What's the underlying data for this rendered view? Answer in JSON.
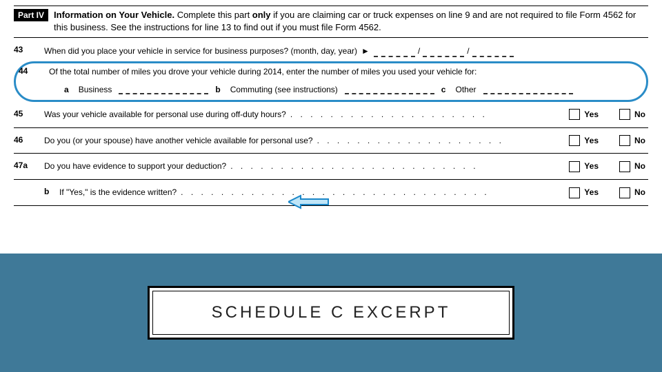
{
  "part": {
    "chip": "Part IV",
    "title": "Information on Your Vehicle.",
    "instruction_a": "Complete this part ",
    "only_word": "only",
    "instruction_b": " if you are claiming car or truck expenses on line 9 and are not required to file Form 4562 for this business. See the instructions for line 13 to find out if you must file Form 4562."
  },
  "lines": {
    "l43": {
      "num": "43",
      "text": "When did you place your vehicle in service for business purposes? (month, day, year)",
      "sep": "/"
    },
    "l44": {
      "num": "44",
      "text": "Of the total number of miles you drove your vehicle during 2014, enter the number of miles you used your vehicle for:",
      "a": {
        "letter": "a",
        "label": "Business"
      },
      "b": {
        "letter": "b",
        "label": "Commuting (see instructions)"
      },
      "c": {
        "letter": "c",
        "label": "Other"
      }
    },
    "l45": {
      "num": "45",
      "text": "Was your vehicle available for personal use during off-duty hours?"
    },
    "l46": {
      "num": "46",
      "text": "Do you (or your spouse) have another vehicle available for personal use?"
    },
    "l47a": {
      "num": "47a",
      "text": "Do you have evidence to support your deduction?"
    },
    "l47b": {
      "letter": "b",
      "text": "If \"Yes,\" is the evidence written?"
    }
  },
  "yesno": {
    "yes": "Yes",
    "no": "No"
  },
  "banner": {
    "title": "SCHEDULE C EXCERPT"
  }
}
